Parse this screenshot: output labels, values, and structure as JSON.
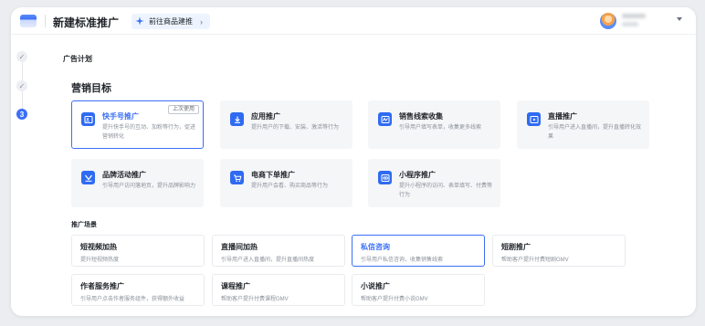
{
  "header": {
    "title": "新建标准推广",
    "goto_label": "前往商品建推",
    "goto_chevron": "›"
  },
  "steps": [
    {
      "label": "✓",
      "state": "done"
    },
    {
      "label": "✓",
      "state": "done"
    },
    {
      "label": "3",
      "state": "current"
    }
  ],
  "section": {
    "title": "广告计划",
    "marketing_goal": "营销目标",
    "scene_title": "推广场景"
  },
  "goals": [
    {
      "title": "快手号推广",
      "desc": "提升快手号的互动、加粉等行为，促进营销转化",
      "tag": "上次使用",
      "selected": true,
      "icon": "profile-card-icon"
    },
    {
      "title": "应用推广",
      "desc": "提升用户的下载、安装、激活等行为",
      "tag": "",
      "selected": false,
      "icon": "download-icon"
    },
    {
      "title": "销售线索收集",
      "desc": "引导用户填写表单，收集更多线索",
      "tag": "",
      "selected": false,
      "icon": "wave-chart-icon"
    },
    {
      "title": "直播推广",
      "desc": "引导用户进入直播间，提升直播转化效果",
      "tag": "",
      "selected": false,
      "icon": "play-icon"
    },
    {
      "title": "品牌活动推广",
      "desc": "引导用户访问落地页，提升品牌影响力",
      "tag": "",
      "selected": false,
      "icon": "flag-icon"
    },
    {
      "title": "电商下单推广",
      "desc": "提升用户会看、购买商品等行为",
      "tag": "",
      "selected": false,
      "icon": "cart-icon"
    },
    {
      "title": "小程序推广",
      "desc": "提升小程序的访问、表单填写、付费等行为",
      "tag": "",
      "selected": false,
      "icon": "mini-program-icon"
    }
  ],
  "scenes": [
    {
      "title": "短视频加热",
      "desc": "提升短视频热度",
      "selected": false
    },
    {
      "title": "直播间加热",
      "desc": "引导用户进入直播间，提升直播间热度",
      "selected": false
    },
    {
      "title": "私信咨询",
      "desc": "引导用户私信咨询，收集销售线索",
      "selected": true
    },
    {
      "title": "短剧推广",
      "desc": "帮助客户提升付费短剧GMV",
      "selected": false
    },
    {
      "title": "作者服务推广",
      "desc": "引导用户点击作者服务组件，获得额外收益",
      "selected": false
    },
    {
      "title": "课程推广",
      "desc": "帮助客户提升付费课程GMV",
      "selected": false
    },
    {
      "title": "小说推广",
      "desc": "帮助客户提升付费小说GMV",
      "selected": false
    }
  ],
  "colors": {
    "accent": "#3a6ff7",
    "card_bg": "#f5f6f8",
    "icon_bg": "#2f6bf2"
  }
}
